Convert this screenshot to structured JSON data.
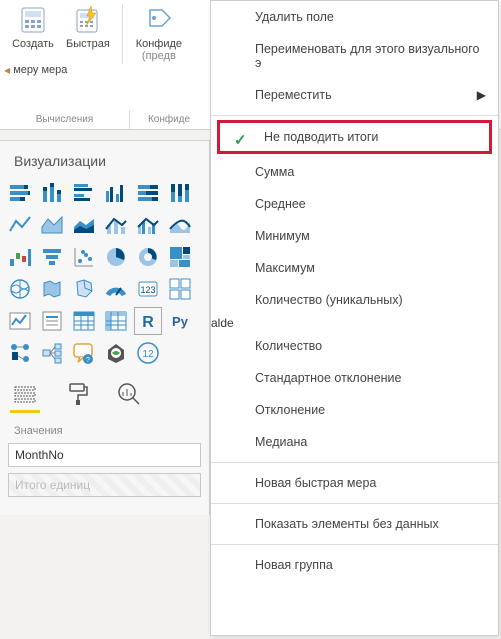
{
  "ribbon": {
    "buttons": {
      "new_measure": "Создать",
      "quick_measure": "Быстрая",
      "confidentiality": "Конфиде",
      "confidentiality_sub": "(предв"
    },
    "join": {
      "left_suffix": "меру",
      "right_word": "мера"
    },
    "groups": {
      "calculations": "Вычисления",
      "confidentiality": "Конфиде"
    }
  },
  "viz": {
    "title": "Визуализации",
    "section_values": "Значения",
    "field_monthno": "MonthNo",
    "field_total_units": "Итого единиц",
    "r_label": "R",
    "py_label": "Py",
    "bubble_label": "12"
  },
  "context_menu": {
    "remove_field": "Удалить поле",
    "rename": "Переименовать для этого визуального э",
    "move": "Переместить",
    "dont_summarize": "Не подводить итоги",
    "sum": "Сумма",
    "average": "Среднее",
    "minimum": "Минимум",
    "maximum": "Максимум",
    "count_distinct": "Количество (уникальных)",
    "count": "Количество",
    "stddev": "Стандартное отклонение",
    "variance": "Отклонение",
    "median": "Медиана",
    "new_quick_measure": "Новая быстрая мера",
    "show_no_data": "Показать элементы без данных",
    "new_group": "Новая группа"
  }
}
